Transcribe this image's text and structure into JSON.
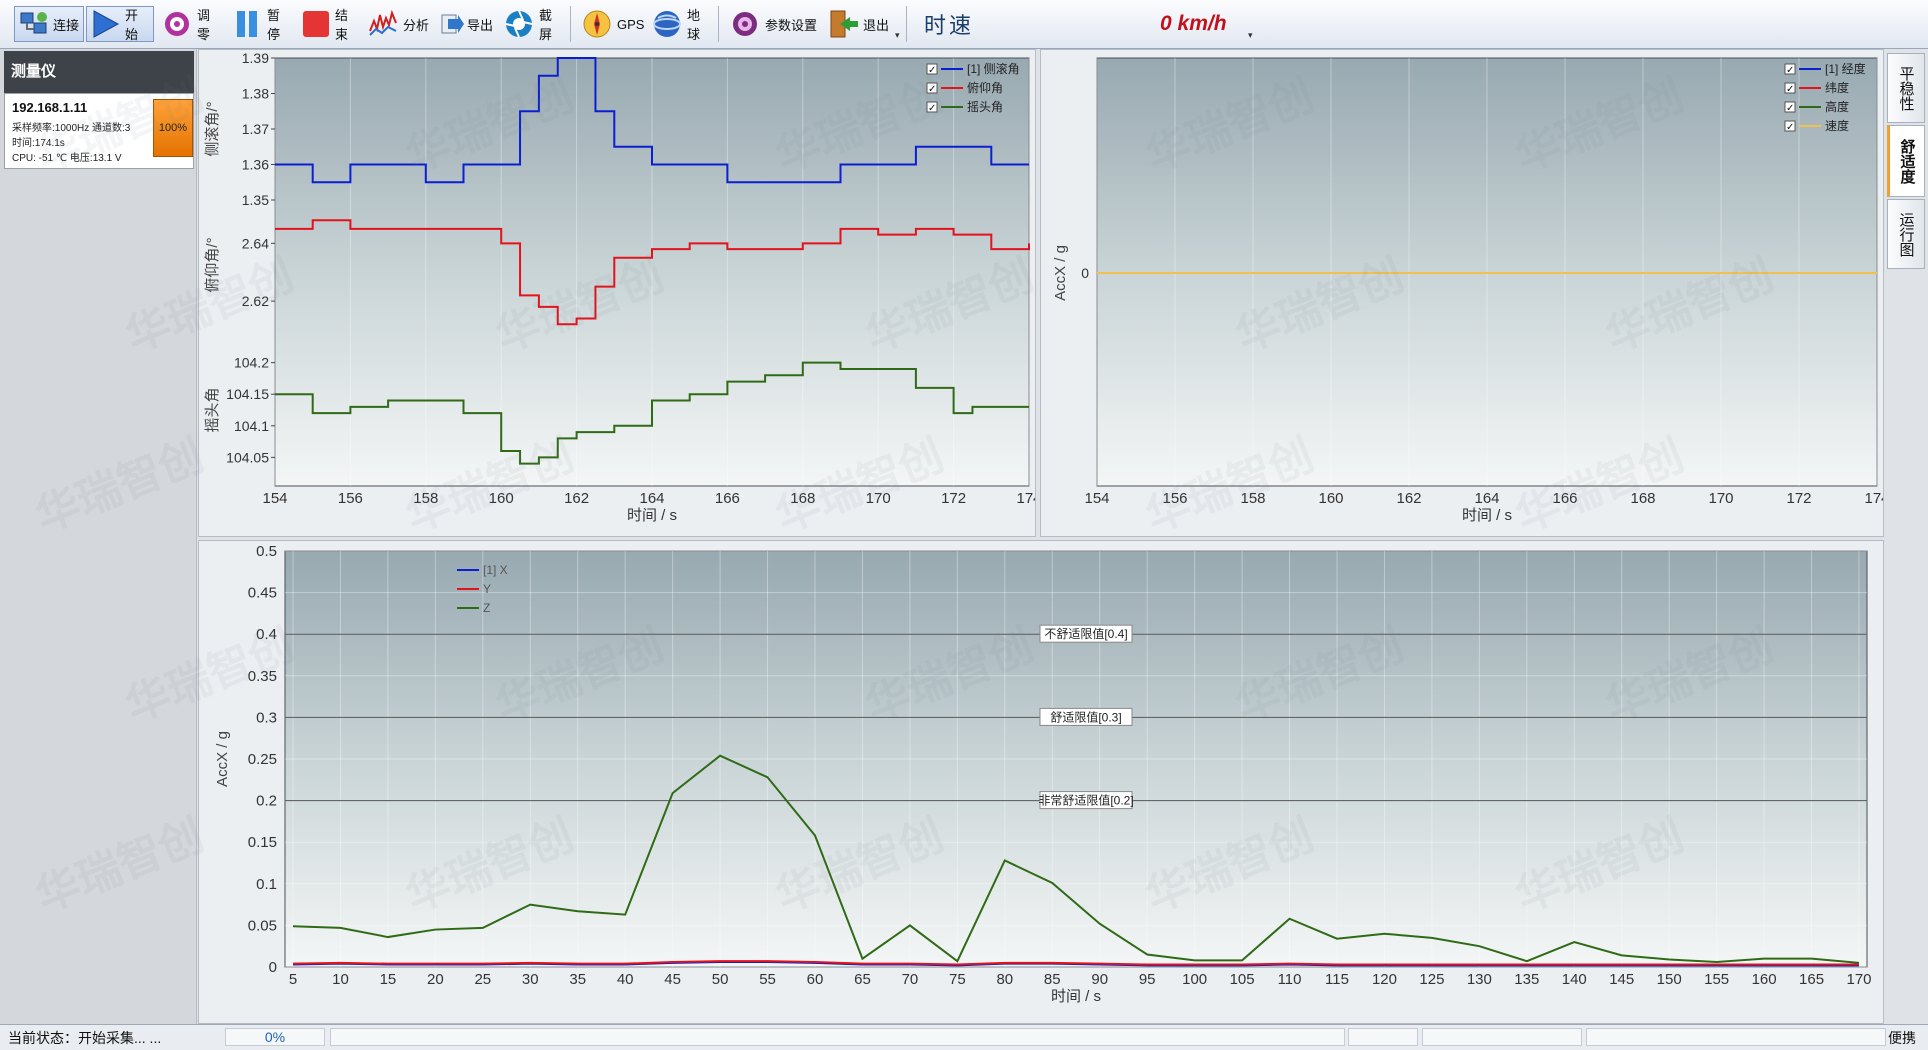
{
  "toolbar": {
    "buttons": [
      {
        "id": "connect",
        "label": "连接",
        "icon": "network-connect-icon"
      },
      {
        "id": "start",
        "label": "开始",
        "icon": "play-icon"
      },
      {
        "id": "zero",
        "label": "调零",
        "icon": "target-zero-icon"
      },
      {
        "id": "pause",
        "label": "暂停",
        "icon": "pause-icon"
      },
      {
        "id": "stop",
        "label": "结束",
        "icon": "stop-icon"
      },
      {
        "id": "analyze",
        "label": "分析",
        "icon": "spectrum-analyze-icon"
      },
      {
        "id": "export",
        "label": "导出",
        "icon": "export-arrow-icon"
      },
      {
        "id": "screenshot",
        "label": "截屏",
        "icon": "camera-aperture-icon"
      },
      {
        "id": "gps",
        "label": "GPS",
        "icon": "compass-icon"
      },
      {
        "id": "earth",
        "label": "地球",
        "icon": "globe-icon"
      },
      {
        "id": "settings",
        "label": "参数设置",
        "icon": "gear-icon"
      },
      {
        "id": "exit",
        "label": "退出",
        "icon": "exit-door-icon"
      }
    ],
    "speed_label": "时速",
    "speed_value": "0 km/h",
    "colors": {
      "play": "#2f6fd1",
      "stop": "#e53434",
      "pause": "#3b8fe0",
      "settings": "#7b2e7f"
    }
  },
  "device": {
    "header": "测量仪",
    "ip": "192.168.1.11",
    "sample_rate": "采样频率:1000Hz 通道数:3",
    "time": "时间:174.1s",
    "cpu_voltage": "CPU: -51 ℃ 电压:13.1 V",
    "battery": "100%"
  },
  "side_tabs": [
    {
      "label": "平稳性",
      "active": false
    },
    {
      "label": "舒适度",
      "active": true
    },
    {
      "label": "运行图",
      "active": false
    }
  ],
  "status": {
    "state": "当前状态：开始采集... ...",
    "progress": "0%",
    "mode": "便携"
  },
  "watermark_text": "华瑞智创",
  "chart_data": [
    {
      "id": "attitude",
      "type": "line",
      "xlabel": "时间 / s",
      "xlim": [
        154,
        174
      ],
      "x_ticks": [
        "154",
        "156",
        "158",
        "160",
        "162",
        "164",
        "166",
        "168",
        "170",
        "172",
        "174"
      ],
      "legend_position": "top-right",
      "series": [
        {
          "name": "[1] 侧滚角",
          "axis_label": "侧滚角/°",
          "color": "#0a1fd0",
          "ylim": [
            1.35,
            1.39
          ],
          "y_ticks": [
            "1.39",
            "1.38",
            "1.37",
            "1.36",
            "1.35"
          ],
          "x": [
            154,
            155,
            156,
            157,
            158,
            159,
            160,
            160.5,
            161,
            161.5,
            162,
            162.5,
            163,
            164,
            165,
            166,
            167,
            168,
            169,
            170,
            171,
            172,
            173,
            174
          ],
          "values": [
            1.36,
            1.355,
            1.36,
            1.36,
            1.355,
            1.36,
            1.36,
            1.375,
            1.385,
            1.39,
            1.39,
            1.375,
            1.365,
            1.36,
            1.36,
            1.355,
            1.355,
            1.355,
            1.36,
            1.36,
            1.365,
            1.365,
            1.36,
            1.36
          ]
        },
        {
          "name": "俯仰角",
          "axis_label": "俯仰角/°",
          "color": "#e3121b",
          "ylim": [
            2.61,
            2.655
          ],
          "y_ticks": [
            "2.64",
            "2.62"
          ],
          "x": [
            154,
            155,
            156,
            157,
            158,
            159,
            160,
            160.5,
            161,
            161.5,
            162,
            162.5,
            163,
            164,
            165,
            166,
            167,
            168,
            169,
            170,
            171,
            172,
            173,
            174
          ],
          "values": [
            2.645,
            2.648,
            2.645,
            2.645,
            2.645,
            2.645,
            2.64,
            2.622,
            2.618,
            2.612,
            2.614,
            2.625,
            2.635,
            2.638,
            2.64,
            2.638,
            2.638,
            2.64,
            2.645,
            2.643,
            2.645,
            2.643,
            2.638,
            2.64
          ]
        },
        {
          "name": "摇头角",
          "axis_label": "摇头角",
          "color": "#2f6b17",
          "ylim": [
            104.03,
            104.22
          ],
          "y_ticks": [
            "104.2",
            "104.15",
            "104.1",
            "104.05"
          ],
          "x": [
            154,
            155,
            156,
            157,
            158,
            159,
            160,
            160.5,
            161,
            161.5,
            162,
            162.5,
            163,
            164,
            165,
            166,
            167,
            168,
            169,
            170,
            171,
            172,
            172.5,
            173,
            174
          ],
          "values": [
            104.15,
            104.12,
            104.13,
            104.14,
            104.14,
            104.12,
            104.06,
            104.04,
            104.05,
            104.08,
            104.09,
            104.09,
            104.1,
            104.14,
            104.15,
            104.17,
            104.18,
            104.2,
            104.19,
            104.19,
            104.16,
            104.12,
            104.13,
            104.13,
            104.13
          ]
        }
      ]
    },
    {
      "id": "gps",
      "type": "line",
      "xlabel": "时间 / s",
      "ylabel": "AccX / g",
      "xlim": [
        154,
        174
      ],
      "x_ticks": [
        "154",
        "156",
        "158",
        "160",
        "162",
        "164",
        "166",
        "168",
        "170",
        "172",
        "174"
      ],
      "y_ticks": [
        "0"
      ],
      "legend_position": "top-right",
      "series": [
        {
          "name": "[1] 经度",
          "color": "#0a1fd0",
          "x": [],
          "values": []
        },
        {
          "name": "纬度",
          "color": "#e3121b",
          "x": [],
          "values": []
        },
        {
          "name": "高度",
          "color": "#2f6b17",
          "x": [],
          "values": []
        },
        {
          "name": "速度",
          "color": "#f0c050",
          "x": [
            154,
            174
          ],
          "values": [
            0,
            0
          ]
        }
      ]
    },
    {
      "id": "comfort",
      "type": "line",
      "xlabel": "时间 / s",
      "ylabel": "AccX / g",
      "xlim": [
        5,
        170
      ],
      "ylim": [
        0,
        0.5
      ],
      "x_ticks": [
        "5",
        "10",
        "15",
        "20",
        "25",
        "30",
        "35",
        "40",
        "45",
        "50",
        "55",
        "60",
        "65",
        "70",
        "75",
        "80",
        "85",
        "90",
        "95",
        "100",
        "105",
        "110",
        "115",
        "120",
        "125",
        "130",
        "135",
        "140",
        "145",
        "150",
        "155",
        "160",
        "165",
        "170"
      ],
      "y_ticks": [
        "0.5",
        "0.45",
        "0.4",
        "0.35",
        "0.3",
        "0.25",
        "0.2",
        "0.15",
        "0.1",
        "0.05",
        "0"
      ],
      "thresholds": [
        {
          "label": "不舒适限值[0.4]",
          "value": 0.4
        },
        {
          "label": "舒适限值[0.3]",
          "value": 0.3
        },
        {
          "label": "非常舒适限值[0.2]",
          "value": 0.2
        }
      ],
      "legend_position": "top-left",
      "series": [
        {
          "name": "[1] X",
          "color": "#0a1fd0",
          "x": [
            5,
            10,
            15,
            20,
            25,
            30,
            35,
            40,
            45,
            50,
            55,
            60,
            65,
            70,
            75,
            80,
            85,
            90,
            95,
            100,
            105,
            110,
            115,
            120,
            125,
            130,
            135,
            140,
            145,
            150,
            155,
            160,
            165,
            170
          ],
          "values": [
            0.003,
            0.004,
            0.003,
            0.003,
            0.003,
            0.004,
            0.003,
            0.003,
            0.005,
            0.006,
            0.006,
            0.005,
            0.003,
            0.003,
            0.002,
            0.004,
            0.004,
            0.003,
            0.002,
            0.002,
            0.002,
            0.003,
            0.002,
            0.002,
            0.002,
            0.002,
            0.002,
            0.002,
            0.002,
            0.002,
            0.002,
            0.002,
            0.002,
            0.002
          ]
        },
        {
          "name": "Y",
          "color": "#e3121b",
          "x": [
            5,
            10,
            15,
            20,
            25,
            30,
            35,
            40,
            45,
            50,
            55,
            60,
            65,
            70,
            75,
            80,
            85,
            90,
            95,
            100,
            105,
            110,
            115,
            120,
            125,
            130,
            135,
            140,
            145,
            150,
            155,
            160,
            165,
            170
          ],
          "values": [
            0.004,
            0.005,
            0.004,
            0.004,
            0.004,
            0.005,
            0.004,
            0.004,
            0.006,
            0.007,
            0.007,
            0.006,
            0.004,
            0.004,
            0.003,
            0.005,
            0.005,
            0.004,
            0.003,
            0.003,
            0.003,
            0.004,
            0.003,
            0.003,
            0.003,
            0.003,
            0.003,
            0.003,
            0.003,
            0.003,
            0.003,
            0.003,
            0.003,
            0.003
          ]
        },
        {
          "name": "Z",
          "color": "#2f6b17",
          "x": [
            5,
            10,
            15,
            20,
            25,
            30,
            35,
            40,
            45,
            50,
            55,
            60,
            65,
            70,
            75,
            80,
            85,
            90,
            95,
            100,
            105,
            110,
            115,
            120,
            125,
            130,
            135,
            140,
            145,
            150,
            155,
            160,
            165,
            170
          ],
          "values": [
            0.049,
            0.047,
            0.036,
            0.045,
            0.047,
            0.075,
            0.067,
            0.063,
            0.209,
            0.254,
            0.228,
            0.158,
            0.01,
            0.05,
            0.007,
            0.128,
            0.101,
            0.052,
            0.015,
            0.008,
            0.008,
            0.058,
            0.034,
            0.04,
            0.035,
            0.025,
            0.007,
            0.03,
            0.014,
            0.009,
            0.006,
            0.01,
            0.01,
            0.005
          ]
        }
      ]
    }
  ]
}
